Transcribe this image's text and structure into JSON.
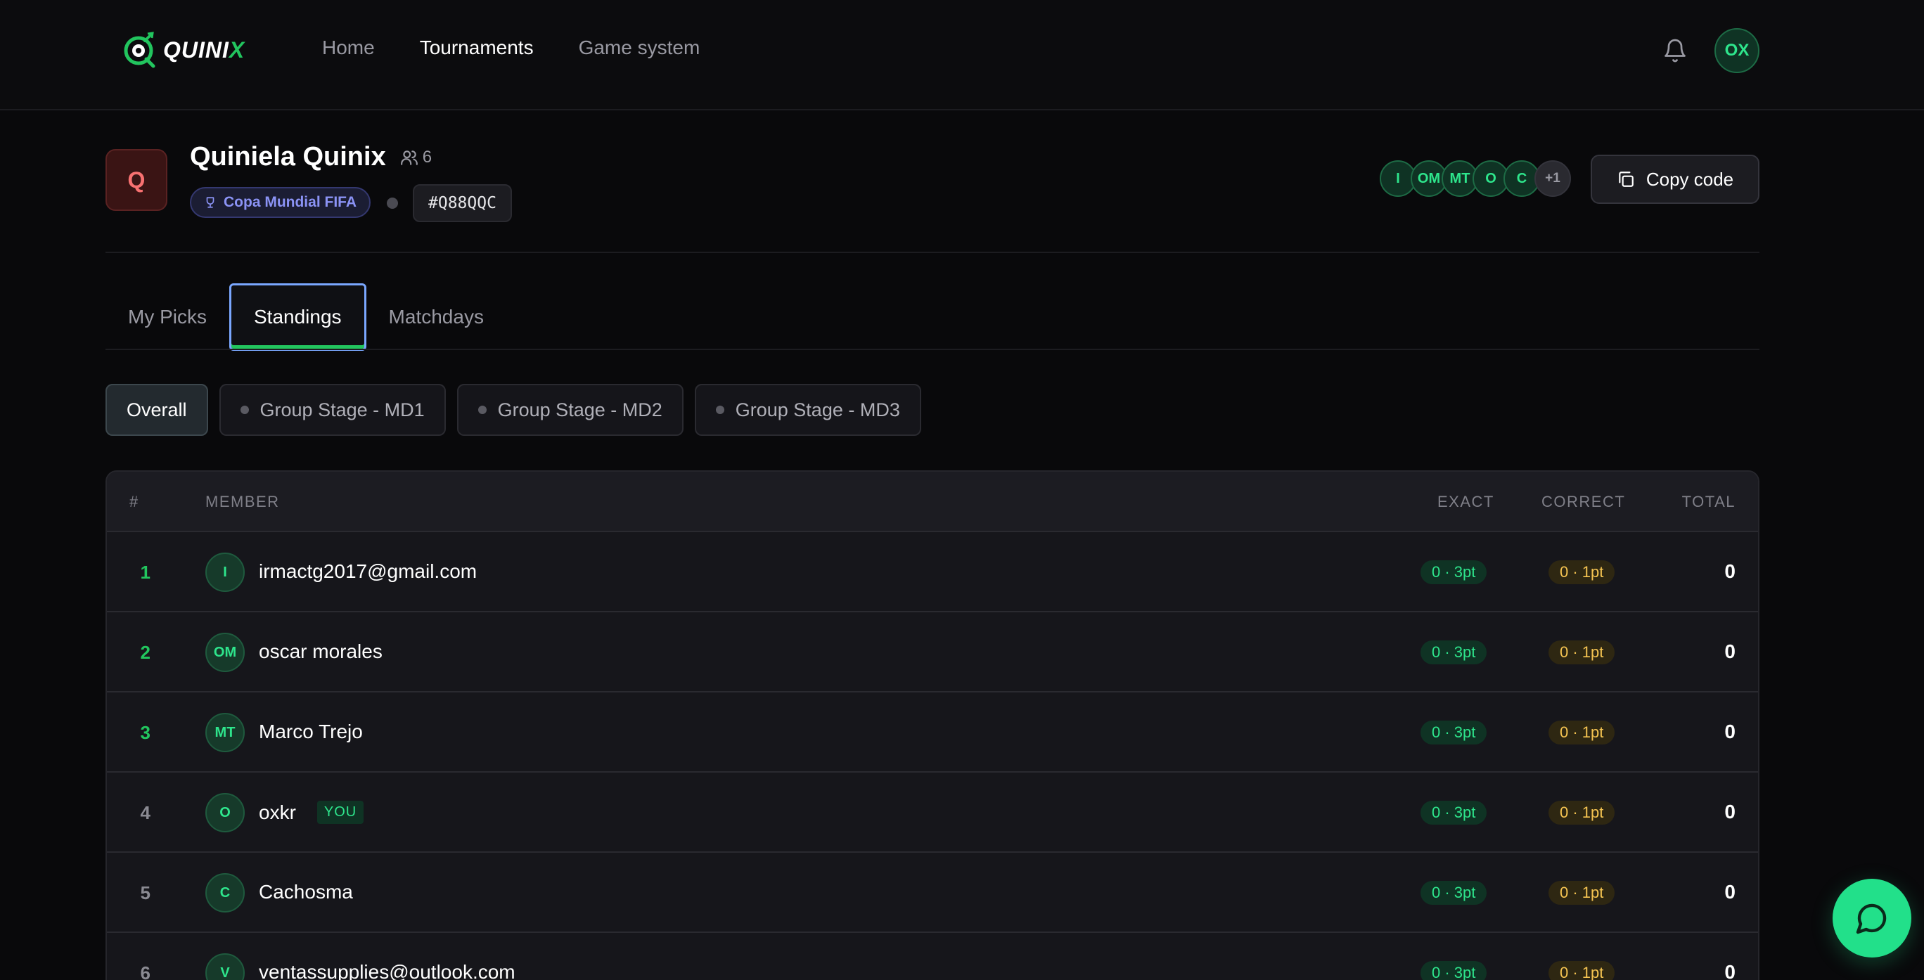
{
  "app": {
    "logo_text_main": "QUINI",
    "logo_text_accent": "X"
  },
  "nav": {
    "items": [
      {
        "label": "Home",
        "active": false
      },
      {
        "label": "Tournaments",
        "active": true
      },
      {
        "label": "Game system",
        "active": false
      }
    ]
  },
  "header": {
    "user_initials": "OX"
  },
  "group": {
    "badge": "Q",
    "name": "Quiniela Quinix",
    "member_count": "6",
    "tournament": "Copa Mundial FIFA",
    "code": "#Q88QQC",
    "member_avatars": [
      "I",
      "OM",
      "MT",
      "O",
      "C"
    ],
    "more_count": "+1",
    "copy_label": "Copy code"
  },
  "tabs": [
    {
      "label": "My Picks",
      "active": false
    },
    {
      "label": "Standings",
      "active": true
    },
    {
      "label": "Matchdays",
      "active": false
    }
  ],
  "filters": [
    {
      "label": "Overall",
      "active": true
    },
    {
      "label": "Group Stage - MD1",
      "active": false
    },
    {
      "label": "Group Stage - MD2",
      "active": false
    },
    {
      "label": "Group Stage - MD3",
      "active": false
    }
  ],
  "table": {
    "columns": {
      "rank": "#",
      "member": "MEMBER",
      "exact": "EXACT",
      "correct": "CORRECT",
      "total": "TOTAL"
    },
    "you_label": "YOU",
    "rows": [
      {
        "rank": "1",
        "initials": "I",
        "name": "irmactg2017@gmail.com",
        "exact": "0 · 3pt",
        "correct": "0 · 1pt",
        "total": "0",
        "you": false
      },
      {
        "rank": "2",
        "initials": "OM",
        "name": "oscar morales",
        "exact": "0 · 3pt",
        "correct": "0 · 1pt",
        "total": "0",
        "you": false
      },
      {
        "rank": "3",
        "initials": "MT",
        "name": "Marco Trejo",
        "exact": "0 · 3pt",
        "correct": "0 · 1pt",
        "total": "0",
        "you": false
      },
      {
        "rank": "4",
        "initials": "O",
        "name": "oxkr",
        "exact": "0 · 3pt",
        "correct": "0 · 1pt",
        "total": "0",
        "you": true
      },
      {
        "rank": "5",
        "initials": "C",
        "name": "Cachosma",
        "exact": "0 · 3pt",
        "correct": "0 · 1pt",
        "total": "0",
        "you": false
      },
      {
        "rank": "6",
        "initials": "V",
        "name": "ventassupplies@outlook.com",
        "exact": "0 · 3pt",
        "correct": "0 · 1pt",
        "total": "0",
        "you": false
      }
    ]
  },
  "colors": {
    "accent": "#22c55e",
    "gold": "#f5c451",
    "background": "#09090b"
  },
  "icons": [
    "logo-icon",
    "bell-icon",
    "users-icon",
    "trophy-icon",
    "copy-icon",
    "chat-icon"
  ]
}
